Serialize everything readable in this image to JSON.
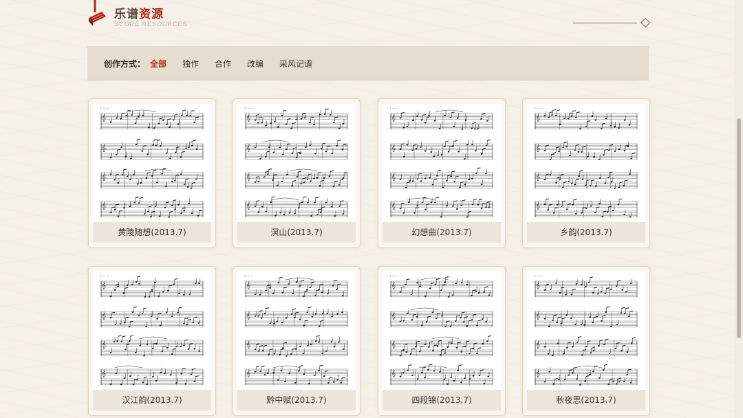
{
  "header": {
    "title_part1": "乐谱",
    "title_part2": "资源",
    "subtitle": "SCORE RESOURCES"
  },
  "filter": {
    "label": "创作方式：",
    "options": [
      "全部",
      "独作",
      "合作",
      "改编",
      "采风记谱"
    ],
    "active": "全部"
  },
  "scores": [
    {
      "title": "黄陵随想(2013.7)",
      "icon": "sheet-music-thumbnail"
    },
    {
      "title": "溟山(2013.7)",
      "icon": "sheet-music-thumbnail"
    },
    {
      "title": "幻想曲(2013.7)",
      "icon": "sheet-music-thumbnail"
    },
    {
      "title": "乡韵(2013.7)",
      "icon": "sheet-music-thumbnail"
    },
    {
      "title": "汉江韵(2013.7)",
      "icon": "sheet-music-thumbnail"
    },
    {
      "title": "黔中赋(2013.7)",
      "icon": "sheet-music-thumbnail"
    },
    {
      "title": "四段锦(2013.7)",
      "icon": "sheet-music-thumbnail"
    },
    {
      "title": "秋夜思(2013.7)",
      "icon": "sheet-music-thumbnail"
    }
  ],
  "colors": {
    "accent": "#b3231c",
    "background": "#f5f0e8",
    "filter_bar": "#e6ddd1",
    "caption_bg": "#ebe5dc"
  }
}
